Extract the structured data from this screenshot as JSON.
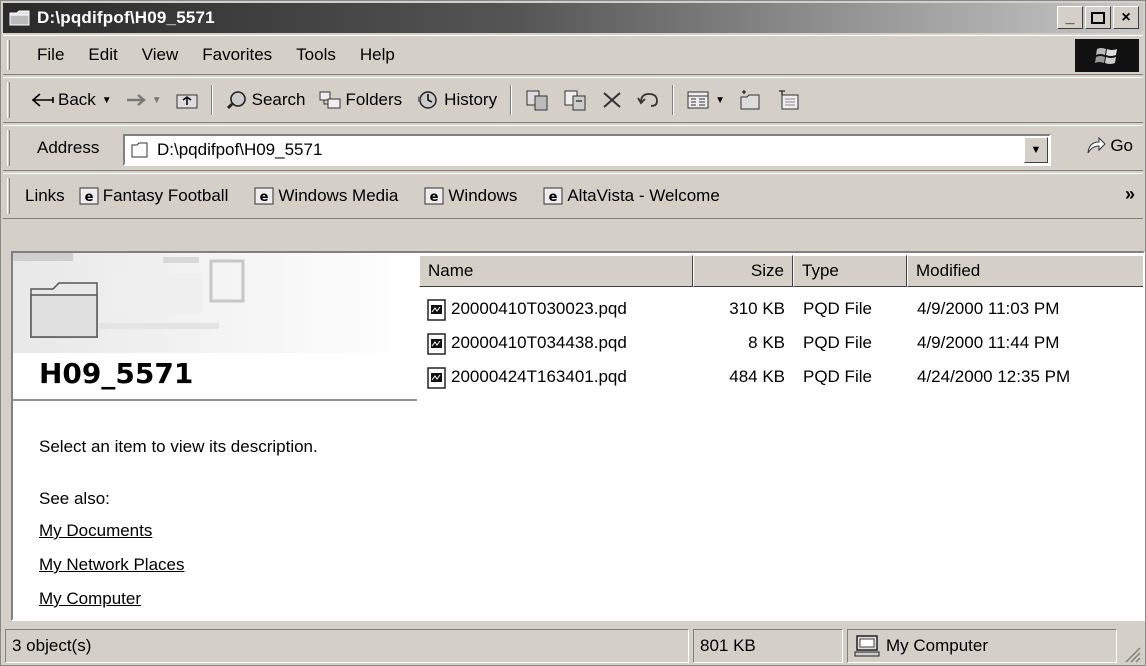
{
  "window": {
    "title": "D:\\pqdifpof\\H09_5571",
    "minimize": "_",
    "maximize": "□",
    "close": "×"
  },
  "menu": [
    "File",
    "Edit",
    "View",
    "Favorites",
    "Tools",
    "Help"
  ],
  "toolbar": {
    "back": "Back",
    "search": "Search",
    "folders": "Folders",
    "history": "History"
  },
  "address": {
    "label": "Address",
    "value": "D:\\pqdifpof\\H09_5571",
    "go": "Go"
  },
  "links": {
    "label": "Links",
    "items": [
      "Fantasy Football",
      "Windows Media",
      "Windows",
      "AltaVista - Welcome"
    ],
    "more": "»"
  },
  "left_pane": {
    "folder_name": "H09_5571",
    "description": "Select an item to view its description.",
    "see_also": "See also:",
    "places": [
      "My Documents",
      "My Network Places",
      "My Computer"
    ]
  },
  "list": {
    "columns": [
      "Name",
      "Size",
      "Type",
      "Modified"
    ],
    "rows": [
      {
        "name": "20000410T030023.pqd",
        "size": "310 KB",
        "type": "PQD File",
        "modified": "4/9/2000 11:03 PM"
      },
      {
        "name": "20000410T034438.pqd",
        "size": "8 KB",
        "type": "PQD File",
        "modified": "4/9/2000 11:44 PM"
      },
      {
        "name": "20000424T163401.pqd",
        "size": "484 KB",
        "type": "PQD File",
        "modified": "4/24/2000 12:35 PM"
      }
    ]
  },
  "status": {
    "objects": "3 object(s)",
    "size": "801 KB",
    "zone": "My Computer"
  }
}
